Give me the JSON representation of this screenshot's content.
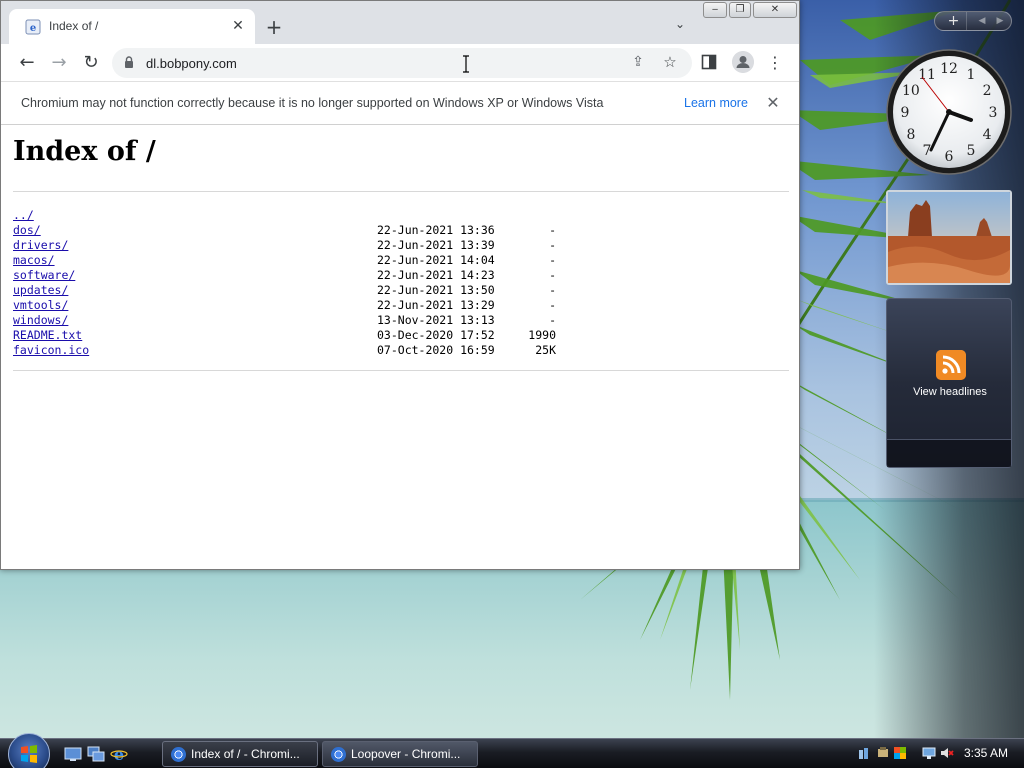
{
  "browser": {
    "tab": {
      "title": "Index of /",
      "close": "✕"
    },
    "new_tab": "+",
    "tab_search": "⌄",
    "window_controls": {
      "min": "‒",
      "max": "❐",
      "close": "✕"
    },
    "nav": {
      "back": "←",
      "forward": "→",
      "reload": "↻"
    },
    "url": "dl.bobpony.com",
    "menu": "⋮",
    "infobar": {
      "text": "Chromium may not function correctly because it is no longer supported on Windows XP or Windows Vista",
      "link": "Learn more",
      "close": "✕"
    }
  },
  "page": {
    "heading": "Index of /",
    "entries": [
      {
        "name": "../",
        "date": "",
        "size": ""
      },
      {
        "name": "dos/",
        "date": "22-Jun-2021 13:36",
        "size": "-"
      },
      {
        "name": "drivers/",
        "date": "22-Jun-2021 13:39",
        "size": "-"
      },
      {
        "name": "macos/",
        "date": "22-Jun-2021 14:04",
        "size": "-"
      },
      {
        "name": "software/",
        "date": "22-Jun-2021 14:23",
        "size": "-"
      },
      {
        "name": "updates/",
        "date": "22-Jun-2021 13:50",
        "size": "-"
      },
      {
        "name": "vmtools/",
        "date": "22-Jun-2021 13:29",
        "size": "-"
      },
      {
        "name": "windows/",
        "date": "13-Nov-2021 13:13",
        "size": "-"
      },
      {
        "name": "README.txt",
        "date": "03-Dec-2020 17:52",
        "size": "1990"
      },
      {
        "name": "favicon.ico",
        "date": "07-Oct-2020 16:59",
        "size": "25K"
      }
    ]
  },
  "gadgets": {
    "toolbar": {
      "add": "+",
      "prev": "◀",
      "next": "▶"
    },
    "clock_numbers": [
      "12",
      "1",
      "2",
      "3",
      "4",
      "5",
      "6",
      "7",
      "8",
      "9",
      "10",
      "11"
    ],
    "feed_label": "View headlines"
  },
  "taskbar": {
    "tasks": [
      {
        "label": "Index of / - Chromi..."
      },
      {
        "label": "Loopover - Chromi..."
      }
    ],
    "time": "3:35 AM"
  },
  "colors": {
    "link": "#1a0dab",
    "info_link": "#1a73e8",
    "tab_strip": "#dee1e6",
    "omnibox": "#f1f3f4"
  }
}
